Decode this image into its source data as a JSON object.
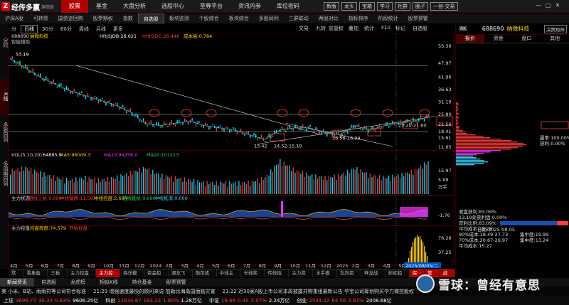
{
  "app": {
    "logo_text": "经传多赢",
    "logo_sub": "旗舰版",
    "logo_mark": "Z"
  },
  "main_nav": [
    "股票",
    "基金",
    "大盘分析",
    "选股中心",
    "至尊平台",
    "资讯内参",
    "库位密码"
  ],
  "main_nav_active": 0,
  "top_tools": [
    "新版",
    "龙头",
    "宝箱",
    "学习",
    "社群",
    "圈子",
    "一创-交易"
  ],
  "window_controls": [
    "—",
    "□",
    "✕"
  ],
  "sub_nav": [
    "沪深A股",
    "可转债",
    "国债逆回购",
    "股票期权",
    "指数",
    "自选股",
    "板块监测",
    "个股综合",
    "板块综合",
    "多股同列",
    "三屏联动",
    "两股对比",
    "指标排序",
    "阶段统计",
    "股票预警"
  ],
  "sub_nav_active": 5,
  "left_strip": [
    "分时",
    "K线",
    "多股同列",
    "多周期同列"
  ],
  "chart_toolbar": {
    "periods": [
      "分",
      "日线",
      "30分",
      "60分",
      "周线",
      "月线",
      "更多"
    ],
    "active": 1,
    "right_items": [
      "交易",
      "九转",
      "前复权",
      "叠加",
      "统计",
      "F10",
      "标记",
      "自选股"
    ]
  },
  "main_chart": {
    "stock_code": "688690",
    "stock_name": "纳微科技",
    "ind_label": "智能辅助",
    "ind1": "HHJSJDB:26.621",
    "ind2": "HHJSJDC:26.446",
    "ind3": "成本高:0.784",
    "peak_label": "53.19",
    "axis": [
      "55.36",
      "47.97",
      "41.96",
      "36.63",
      "31.19",
      "25.80",
      "21.56",
      "18.41",
      "15.61",
      "11.65"
    ],
    "annotations": [
      "13.42",
      "14.52-15.19",
      "16.56-16.99",
      "21.20-21.60"
    ],
    "current_price": "23.27"
  },
  "chart_data": [
    {
      "type": "line",
      "title": "",
      "xlabel": "",
      "ylabel": "",
      "x": [
        "2023-04",
        "2023-05",
        "2023-06",
        "2023-07",
        "2023-08",
        "2023-09",
        "2023-10",
        "2023-11",
        "2023-12",
        "2024-01",
        "2024-02",
        "2024-03",
        "2024-04",
        "2024-05",
        "2024-06",
        "2024-07",
        "2024-08",
        "2024-09",
        "2024-10",
        "2024-11",
        "2024-12",
        "2025-01",
        "2025-02",
        "2025-03",
        "2025-04",
        "2025-05",
        "2025-06",
        "2025-07",
        "2025-08"
      ],
      "series": [
        {
          "name": "",
          "values": [
            50,
            46,
            42,
            39,
            36,
            34,
            32,
            30,
            27,
            22,
            21,
            22,
            23,
            21,
            20,
            19,
            17,
            15,
            19,
            20,
            20,
            18,
            17,
            21,
            19,
            21,
            22,
            23,
            25
          ]
        }
      ],
      "ylim": [
        11.65,
        55.36
      ]
    },
    {
      "type": "bar",
      "title": "",
      "series": [
        {
          "name": "VOL",
          "values": [
            8,
            9,
            7,
            5,
            4,
            5,
            4,
            5,
            7,
            9,
            6,
            5,
            4,
            3,
            3,
            3,
            3,
            5,
            12,
            8,
            6,
            5,
            6,
            9,
            6,
            5,
            6,
            8,
            12
          ]
        }
      ],
      "legend": [
        "VOL(5,10,20)",
        "64885.9",
        "MA5:96009.3",
        "MA10:99256.0",
        "MA20:101213"
      ],
      "axis": [
        "15.97",
        "5.99",
        "万手"
      ]
    },
    {
      "type": "area",
      "title": "",
      "legend": [
        "主力状态",
        "粗线上抗:0.000",
        "中线循数:11.563",
        "中线控盘:2.664",
        "粗线抵抗:0.000",
        "中线抵消:0.000"
      ],
      "axis": [
        "-1.76"
      ]
    },
    {
      "type": "bar",
      "title": "",
      "series": [
        {
          "name": "控盘程度",
          "values": [
            0,
            0,
            0,
            0,
            0,
            0,
            0,
            0,
            0,
            0,
            0,
            0,
            0,
            0,
            0,
            0,
            0,
            0,
            0,
            0,
            0,
            0,
            0,
            0,
            0,
            0,
            20,
            60,
            80
          ]
        }
      ],
      "legend": [
        "主力控盘",
        "控盘程度:74.579",
        "开始控盘:"
      ],
      "axis": [
        "76.26",
        "37.25"
      ]
    }
  ],
  "time_axis": [
    "4月",
    "5月",
    "6月",
    "7月",
    "8月",
    "9月",
    "10月",
    "11月",
    "12月",
    "2024",
    "2月",
    "3月",
    "4月",
    "5月",
    "6月",
    "7月",
    "8月",
    "9月",
    "10月",
    "11月",
    "12月",
    "2025",
    "2月",
    "3月",
    "4月",
    "5月",
    "6月",
    "7月"
  ],
  "date_highlight": "2025/08/05/二",
  "right_panel": {
    "badge": "RK",
    "code": "688690",
    "name": "纳微科技",
    "button": "决策矩阵",
    "tabs": [
      "报价",
      "资金",
      "盘口",
      "其他"
    ],
    "active_tab": 0,
    "chip_stats1": [
      "露率:100.00%",
      "获利:0.00%"
    ],
    "chip_date": "日期:2025-08-05",
    "chip_stats2": [
      "收盘获利:83.09%",
      "13.19处获利盘:0.00%",
      "获利比例:83.09%",
      "平均成本:23.28",
      "90%成本:18.49-27.73",
      "集中度:19.99",
      "70%成本:20.67-26.97",
      "集中度:13.24",
      "平均成本:15.27"
    ]
  },
  "bottom_tabs1": [
    "默认",
    "看象盈游",
    "三板斧",
    "主力控盘王",
    "主力控盘",
    "海洋模式",
    "资金趋势",
    "潮龙飞天",
    "筋花成桶",
    "中线主力",
    "长线奖入",
    "传统指标",
    "主力资金",
    "水手模式",
    "北向资金",
    "神龙战法",
    "彩虹趋势",
    "保存",
    "管理",
    "战法"
  ],
  "bottom_tabs1_active": 4,
  "bottom_tabs2": [
    "新闻资讯",
    "自选股",
    "龙虎榜",
    "相似K线",
    "持仓基金",
    "股票预警"
  ],
  "ticker": [
    "美 小米、B站、雨雨符等公司符合标准",
    "21:29 增强速度最快的顾问来说 加勒比海岛国面临灾害",
    "21:22 近30家A股上市公司本周披露并购重组最新公告 华宝公司筹划购买华力微控股权"
  ],
  "status": [
    {
      "label": "上证",
      "price": "3696.77",
      "chg": "30.33",
      "pct": "0.83%",
      "amt": "9606.25亿"
    },
    {
      "label": "科创",
      "price": "11634.67",
      "chg": "183.23",
      "pct": "1.60%",
      "amt": "1.28万亿"
    },
    {
      "label": "中证",
      "price": "19.69",
      "chg": "0.40",
      "pct": "2.07%",
      "amt": "2.24万亿"
    },
    {
      "label": "创业",
      "price": "2534.22",
      "chg": "64.56",
      "pct": "2.61%",
      "amt": "2008.68亿"
    }
  ],
  "status_time": "10:12",
  "watermark": {
    "text": "雪球：曾经有意思"
  }
}
